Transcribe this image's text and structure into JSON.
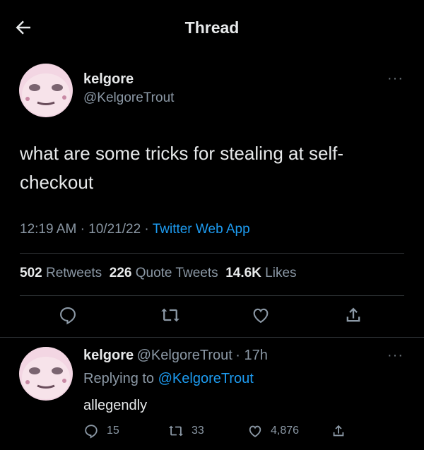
{
  "header": {
    "title": "Thread"
  },
  "tweet": {
    "display_name": "kelgore",
    "handle": "@KelgoreTrout",
    "text": "what are some tricks for stealing at self-checkout",
    "time": "12:19 AM",
    "date": "10/21/22",
    "source": "Twitter Web App",
    "stats": {
      "retweets_count": "502",
      "retweets_label": "Retweets",
      "quotes_count": "226",
      "quotes_label": "Quote Tweets",
      "likes_count": "14.6K",
      "likes_label": "Likes"
    }
  },
  "reply": {
    "display_name": "kelgore",
    "handle": "@KelgoreTrout",
    "age": "17h",
    "replying_prefix": "Replying to",
    "replying_mention": "@KelgoreTrout",
    "text": "allegendly",
    "replies": "15",
    "retweets": "33",
    "likes": "4,876"
  },
  "colors": {
    "accent": "#1d9bf0",
    "muted": "#8b98a5",
    "background": "#000000"
  }
}
